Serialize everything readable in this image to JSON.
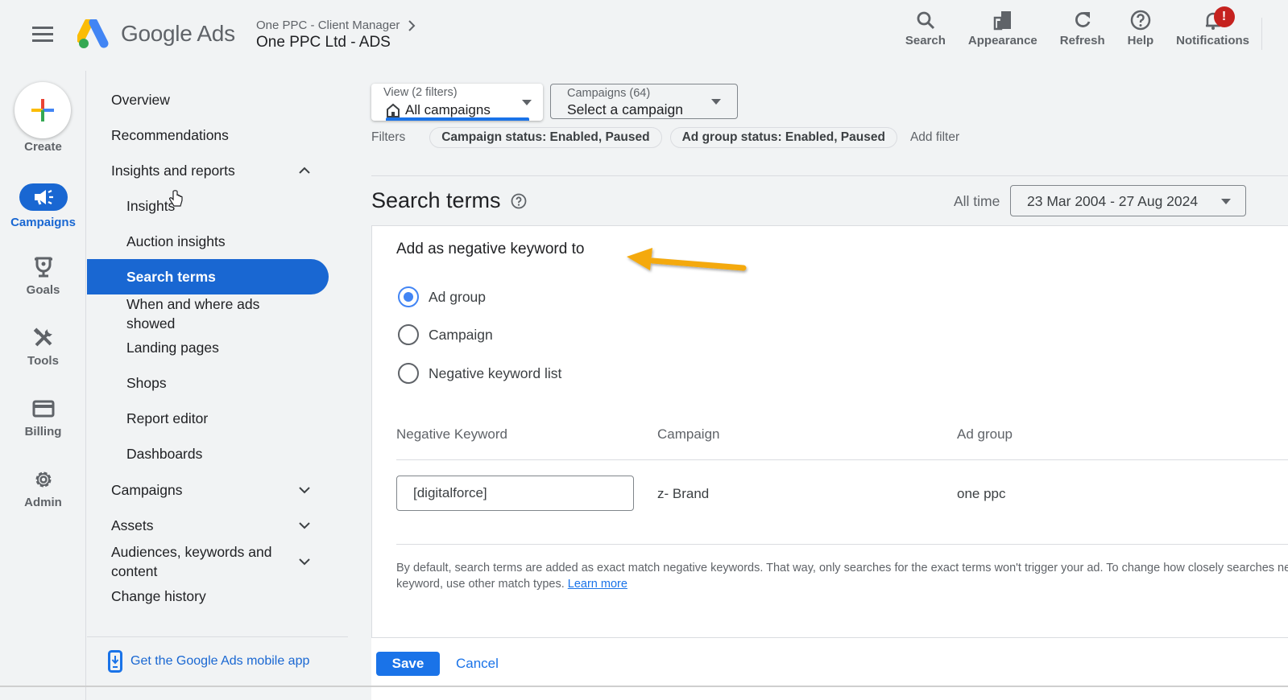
{
  "header": {
    "app_name": "Google Ads",
    "manager_account": "One PPC - Client Manager",
    "account_name": "One PPC Ltd - ADS",
    "actions": [
      {
        "label": "Search",
        "icon": "search-icon"
      },
      {
        "label": "Appearance",
        "icon": "appearance-icon"
      },
      {
        "label": "Refresh",
        "icon": "refresh-icon"
      },
      {
        "label": "Help",
        "icon": "help-icon"
      },
      {
        "label": "Notifications",
        "icon": "bell-icon",
        "badge": "!"
      }
    ]
  },
  "rail": {
    "create_label": "Create",
    "items": [
      {
        "label": "Campaigns",
        "icon": "megaphone-icon",
        "active": true
      },
      {
        "label": "Goals",
        "icon": "trophy-icon"
      },
      {
        "label": "Tools",
        "icon": "tools-icon"
      },
      {
        "label": "Billing",
        "icon": "credit-card-icon"
      },
      {
        "label": "Admin",
        "icon": "gear-icon"
      }
    ]
  },
  "nav": {
    "items": [
      {
        "label": "Overview",
        "level": 1
      },
      {
        "label": "Recommendations",
        "level": 1
      },
      {
        "label": "Insights and reports",
        "level": 1,
        "expanded": true
      },
      {
        "label": "Insights",
        "level": 2
      },
      {
        "label": "Auction insights",
        "level": 2
      },
      {
        "label": "Search terms",
        "level": 2,
        "active": true
      },
      {
        "label": "When and where ads showed",
        "level": 2
      },
      {
        "label": "Landing pages",
        "level": 2
      },
      {
        "label": "Shops",
        "level": 2
      },
      {
        "label": "Report editor",
        "level": 2
      },
      {
        "label": "Dashboards",
        "level": 2
      },
      {
        "label": "Campaigns",
        "level": 1,
        "expanded": false
      },
      {
        "label": "Assets",
        "level": 1,
        "expanded": false
      },
      {
        "label": "Audiences, keywords and content",
        "level": 1,
        "expanded": false
      },
      {
        "label": "Change history",
        "level": 1
      }
    ],
    "mobile_app_link": "Get the Google Ads mobile app"
  },
  "toolbar": {
    "view_label": "View (2 filters)",
    "view_value": "All campaigns",
    "campaigns_label": "Campaigns (64)",
    "campaigns_value": "Select a campaign",
    "filters_label": "Filters",
    "filter_chips": [
      "Campaign status: Enabled, Paused",
      "Ad group status: Enabled, Paused"
    ],
    "add_filter": "Add filter"
  },
  "page": {
    "title": "Search terms",
    "date_range_label": "All time",
    "date_range_value": "23 Mar 2004 - 27 Aug 2024"
  },
  "negative_keyword_form": {
    "title": "Add as negative keyword to",
    "options": [
      {
        "label": "Ad group",
        "selected": true
      },
      {
        "label": "Campaign",
        "selected": false
      },
      {
        "label": "Negative keyword list",
        "selected": false
      }
    ],
    "columns": [
      "Negative Keyword",
      "Campaign",
      "Ad group"
    ],
    "rows": [
      {
        "keyword": "[digitalforce]",
        "campaign": "z- Brand",
        "ad_group": "one ppc"
      }
    ],
    "note_line1": "By default, search terms are added as exact match negative keywords. That way, only searches for the exact terms won't trigger your ad. To change how closely searches need to match your",
    "note_line2": "keyword, use other match types.",
    "learn_more": "Learn more",
    "save_label": "Save",
    "cancel_label": "Cancel"
  },
  "colors": {
    "accent": "#1967d2",
    "button": "#1a73e8",
    "notification_badge": "#c5221f",
    "annotation_arrow": "#f4a90c"
  }
}
